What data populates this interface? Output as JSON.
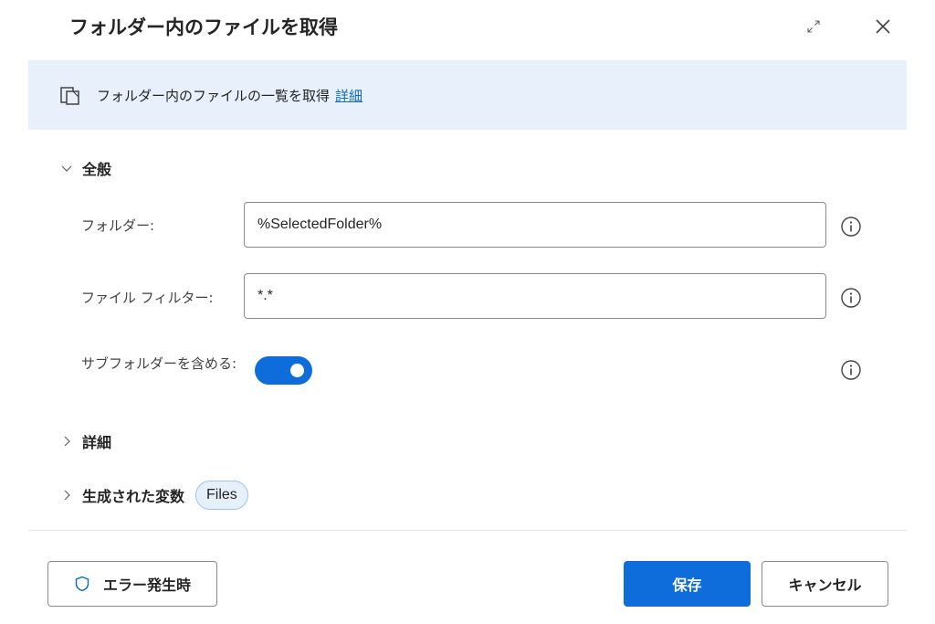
{
  "dialog": {
    "title": "フォルダー内のファイルを取得"
  },
  "banner": {
    "icon": "document-copy-icon",
    "description": "フォルダー内のファイルの一覧を取得",
    "link_label": "詳細"
  },
  "sections": {
    "general": {
      "label": "全般",
      "expanded": true
    },
    "details": {
      "label": "詳細",
      "expanded": false
    },
    "variables": {
      "label": "生成された変数",
      "expanded": false,
      "chip": "Files"
    }
  },
  "fields": {
    "folder": {
      "label": "フォルダー:",
      "value": "%SelectedFolder%"
    },
    "file_filter": {
      "label": "ファイル フィルター:",
      "value": "*.*"
    },
    "include_subfolders": {
      "label": "サブフォルダーを含める:",
      "on": true
    }
  },
  "buttons": {
    "on_error": "エラー発生時",
    "save": "保存",
    "cancel": "キャンセル"
  },
  "colors": {
    "accent": "#0f6cdb",
    "banner_bg": "#e8f1fb",
    "link": "#0f6cbd"
  }
}
